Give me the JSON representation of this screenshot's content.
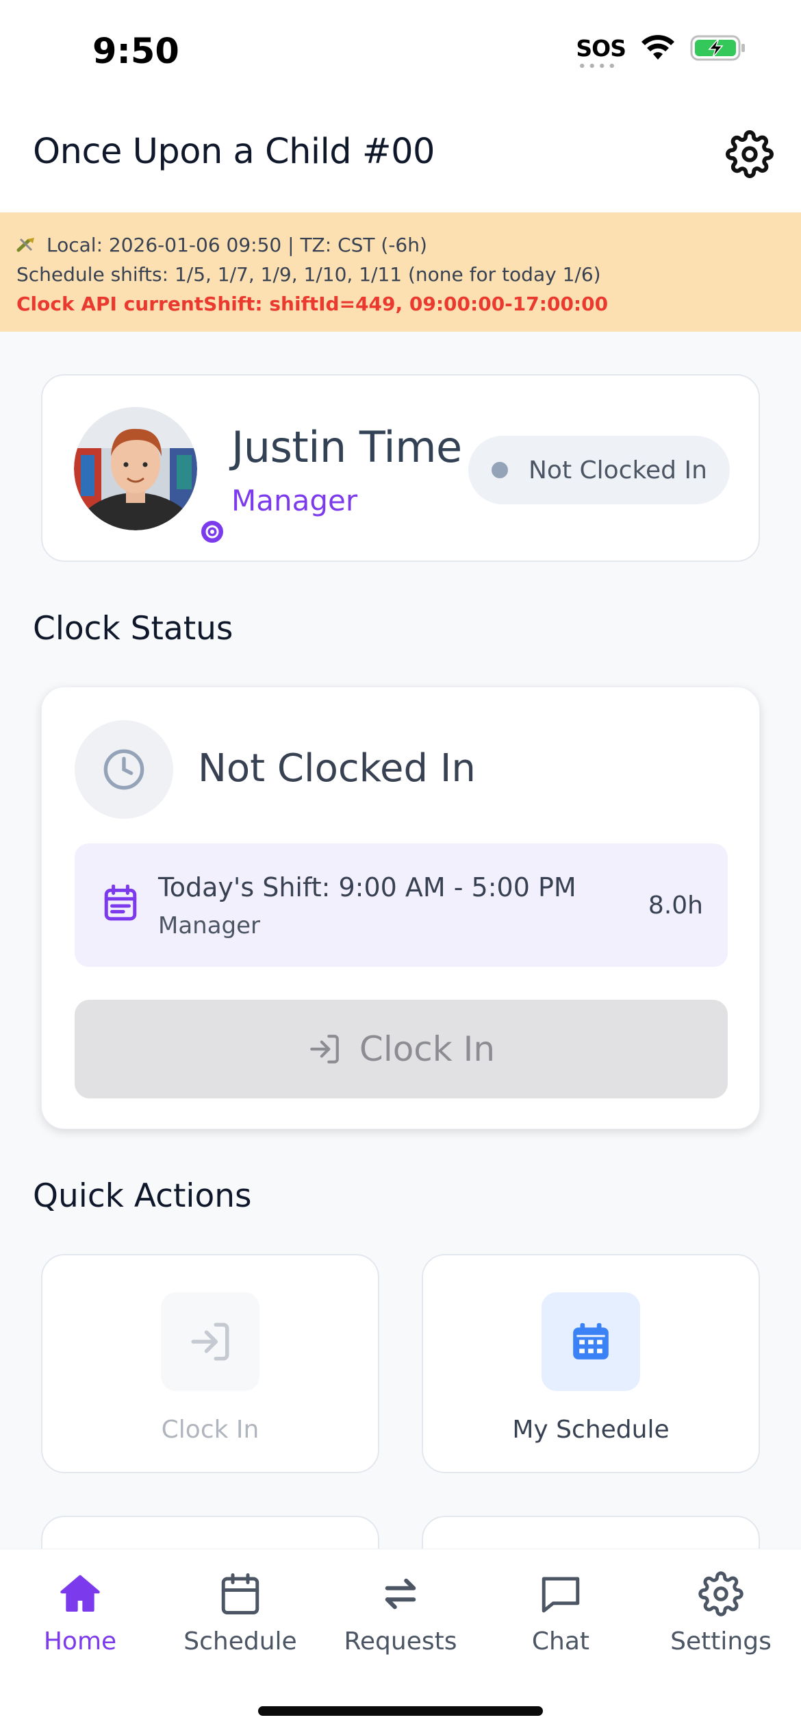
{
  "status_bar": {
    "time": "9:50",
    "sos": "SOS",
    "icons": [
      "wifi-icon",
      "battery-charging-icon"
    ]
  },
  "header": {
    "title": "Once Upon a Child #00",
    "settings_icon": "gear-icon"
  },
  "debug": {
    "line1": "Local: 2026-01-06 09:50 | TZ: CST (-6h)",
    "line2": "Schedule shifts: 1/5, 1/7, 1/9, 1/10, 1/11 (none for today 1/6)",
    "line3": "Clock API currentShift: shiftId=449, 09:00:00-17:00:00",
    "error_color": "#ea3a2f"
  },
  "profile": {
    "name": "Justin Time",
    "role": "Manager",
    "status": "Not Clocked In"
  },
  "clock_status": {
    "section_title": "Clock Status",
    "heading": "Not Clocked In",
    "shift_text": "Today's Shift: 9:00 AM - 5:00 PM",
    "shift_role": "Manager",
    "shift_hours": "8.0h",
    "button_label": "Clock In"
  },
  "quick_actions": {
    "section_title": "Quick Actions",
    "items": [
      {
        "label": "Clock In",
        "icon": "clock-in-icon",
        "enabled": false
      },
      {
        "label": "My Schedule",
        "icon": "calendar-icon",
        "enabled": true
      }
    ]
  },
  "tabs": [
    {
      "label": "Home",
      "icon": "home-icon",
      "active": true
    },
    {
      "label": "Schedule",
      "icon": "calendar-icon",
      "active": false
    },
    {
      "label": "Requests",
      "icon": "swap-arrows-icon",
      "active": false
    },
    {
      "label": "Chat",
      "icon": "chat-bubble-icon",
      "active": false
    },
    {
      "label": "Settings",
      "icon": "gear-icon",
      "active": false
    }
  ],
  "colors": {
    "accent": "#7c3aed",
    "banner_bg": "#fde0b2",
    "schedule_blue": "#3b82f6"
  }
}
